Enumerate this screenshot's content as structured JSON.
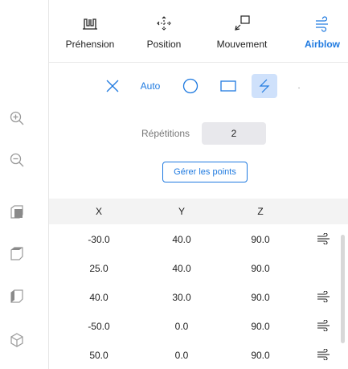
{
  "tabs": [
    {
      "label": "Préhension",
      "icon": "gripper-icon",
      "active": false
    },
    {
      "label": "Position",
      "icon": "move-arrows-icon",
      "active": false
    },
    {
      "label": "Mouvement",
      "icon": "movement-icon",
      "active": false
    },
    {
      "label": "Airblow",
      "icon": "airblow-icon",
      "active": true
    }
  ],
  "modes": {
    "auto_label": "Auto",
    "dot_label": "."
  },
  "repetitions": {
    "label": "Répétitions",
    "value": "2"
  },
  "manage_points_label": "Gérer les points",
  "table": {
    "headers": {
      "x": "X",
      "y": "Y",
      "z": "Z"
    },
    "rows": [
      {
        "x": "-30.0",
        "y": "40.0",
        "z": "90.0",
        "airblow": true
      },
      {
        "x": "25.0",
        "y": "40.0",
        "z": "90.0",
        "airblow": false
      },
      {
        "x": "40.0",
        "y": "30.0",
        "z": "90.0",
        "airblow": true
      },
      {
        "x": "-50.0",
        "y": "0.0",
        "z": "90.0",
        "airblow": true
      },
      {
        "x": "50.0",
        "y": "0.0",
        "z": "90.0",
        "airblow": true
      }
    ]
  },
  "left_toolbar": [
    "zoom-in-icon",
    "zoom-out-icon",
    "cube-front-view-icon",
    "cube-top-view-icon",
    "cube-side-view-icon",
    "cube-iso-view-icon"
  ],
  "colors": {
    "accent": "#1f7ae0",
    "selected_bg": "#cfe1fb"
  }
}
